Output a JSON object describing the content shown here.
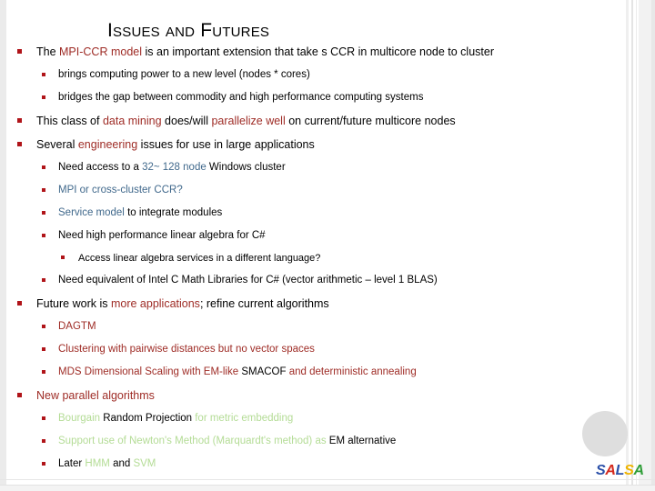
{
  "slide": {
    "title": "Issues and Futures",
    "logo": {
      "name": "SALSA",
      "letters": [
        "S",
        "A",
        "L",
        "S",
        "A"
      ],
      "colors": [
        "#2a4fa8",
        "#d42a1e",
        "#2a4fa8",
        "#efb400",
        "#2f9e38"
      ]
    },
    "theme": {
      "bullet_color": "#b01419",
      "accent_red": "#9e2b25",
      "accent_blue": "#41698c",
      "accent_green": "#b4dc96",
      "text_color": "#000000",
      "background": "#ffffff"
    },
    "bullets": [
      {
        "id": "mpi-ccr-model",
        "level": 1,
        "runs": [
          {
            "text": "The ",
            "color": "black"
          },
          {
            "text": "MPI-CCR model",
            "color": "red"
          },
          {
            "text": " is an important  extension  that take s CCR in multicore node to cluster",
            "color": "black"
          }
        ]
      },
      {
        "id": "brings-computing-power",
        "level": 2,
        "runs": [
          {
            "text": "brings  computing power to a new level (nodes * cores)",
            "color": "black"
          }
        ]
      },
      {
        "id": "bridges-the-gap",
        "level": 2,
        "runs": [
          {
            "text": "bridges the gap between commodity and high performance computing systems",
            "color": "black"
          }
        ]
      },
      {
        "id": "data-mining-parallelize",
        "level": 1,
        "runs": [
          {
            "text": "This class of ",
            "color": "black"
          },
          {
            "text": "data mining",
            "color": "red"
          },
          {
            "text": " does/will ",
            "color": "black"
          },
          {
            "text": "parallelize well",
            "color": "red"
          },
          {
            "text": " on current/future multicore nodes",
            "color": "black"
          }
        ]
      },
      {
        "id": "engineering-issues",
        "level": 1,
        "runs": [
          {
            "text": "Several ",
            "color": "black"
          },
          {
            "text": "engineering",
            "color": "red"
          },
          {
            "text": " issues for use in large applications",
            "color": "black"
          }
        ]
      },
      {
        "id": "need-windows-cluster",
        "level": 2,
        "runs": [
          {
            "text": "Need access to a ",
            "color": "black"
          },
          {
            "text": "32~ 128 node",
            "color": "blue"
          },
          {
            "text": " Windows cluster",
            "color": "black"
          }
        ]
      },
      {
        "id": "mpi-or-cross-cluster-ccr",
        "level": 2,
        "runs": [
          {
            "text": "MPI or cross-cluster CCR?",
            "color": "blue"
          }
        ]
      },
      {
        "id": "service-model",
        "level": 2,
        "runs": [
          {
            "text": "Service model",
            "color": "blue"
          },
          {
            "text": " to integrate modules",
            "color": "black"
          }
        ]
      },
      {
        "id": "need-linear-algebra-csharp",
        "level": 2,
        "runs": [
          {
            "text": "Need high performance linear algebra for C#",
            "color": "black"
          }
        ]
      },
      {
        "id": "access-linear-algebra-services",
        "level": 3,
        "runs": [
          {
            "text": "Access linear algebra services in a different language?",
            "color": "black"
          }
        ]
      },
      {
        "id": "need-intel-c-math-libraries",
        "level": 2,
        "runs": [
          {
            "text": "Need equivalent of Intel C Math Libraries for C# (vector arithmetic – level 1 BLAS)",
            "color": "black"
          }
        ]
      },
      {
        "id": "future-work",
        "level": 1,
        "runs": [
          {
            "text": "Future work is ",
            "color": "black"
          },
          {
            "text": "more applications",
            "color": "red"
          },
          {
            "text": "; refine current algorithms",
            "color": "black"
          }
        ]
      },
      {
        "id": "dagtm",
        "level": 2,
        "runs": [
          {
            "text": "DAGTM",
            "color": "red"
          }
        ]
      },
      {
        "id": "clustering-pairwise",
        "level": 2,
        "runs": [
          {
            "text": "Clustering with pairwise distances but no vector spaces",
            "color": "red"
          }
        ]
      },
      {
        "id": "mds-dimensional-scaling",
        "level": 2,
        "runs": [
          {
            "text": "MDS Dimensional Scaling with EM-like ",
            "color": "red"
          },
          {
            "text": "SMACOF",
            "color": "black"
          },
          {
            "text": " and ",
            "color": "red"
          },
          {
            "text": "deterministic annealing",
            "color": "red"
          }
        ]
      },
      {
        "id": "new-parallel-algorithms",
        "level": 1,
        "runs": [
          {
            "text": "New parallel algorithms",
            "color": "red"
          }
        ]
      },
      {
        "id": "bourgain-random-projection",
        "level": 2,
        "runs": [
          {
            "text": "Bourgain ",
            "color": "green"
          },
          {
            "text": "Random Projection",
            "color": "black"
          },
          {
            "text": " for metric embedding",
            "color": "green"
          }
        ]
      },
      {
        "id": "newtons-method",
        "level": 2,
        "runs": [
          {
            "text": "Support use of Newton's Method (Marquardt's method) as ",
            "color": "green"
          },
          {
            "text": "EM alternative",
            "color": "black"
          }
        ]
      },
      {
        "id": "later-hmm-svm",
        "level": 2,
        "runs": [
          {
            "text": "Later ",
            "color": "black"
          },
          {
            "text": "HMM",
            "color": "green"
          },
          {
            "text": " and ",
            "color": "black"
          },
          {
            "text": "SVM",
            "color": "green"
          }
        ]
      }
    ]
  }
}
